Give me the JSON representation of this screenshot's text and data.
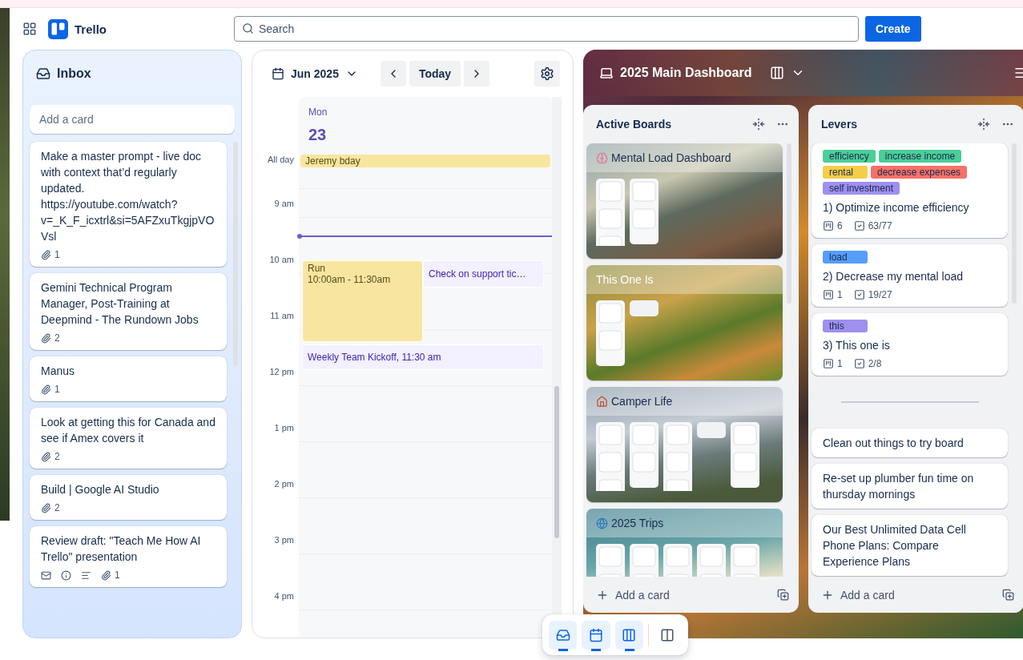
{
  "header": {
    "app_name": "Trello",
    "search": {
      "placeholder": "Search"
    },
    "create_label": "Create"
  },
  "inbox": {
    "title": "Inbox",
    "add_placeholder": "Add a card",
    "cards": [
      {
        "title": "Make a master prompt - live doc with context that’d regularly updated. https://youtube.com/watch?v=_K_F_icxtrl&si=5AFZxuTkgjpVOVsl",
        "badges": [
          {
            "kind": "attachment",
            "count": "1"
          }
        ]
      },
      {
        "title": "Gemini Technical Program Manager, Post-Training at Deepmind - The Rundown Jobs",
        "badges": [
          {
            "kind": "attachment",
            "count": "2"
          }
        ]
      },
      {
        "title": "Manus",
        "badges": [
          {
            "kind": "attachment",
            "count": "1"
          }
        ]
      },
      {
        "title": "Look at getting this for Canada and see if Amex covers it",
        "badges": [
          {
            "kind": "attachment",
            "count": "2"
          }
        ]
      },
      {
        "title": "Build | Google AI Studio",
        "badges": [
          {
            "kind": "attachment",
            "count": "2"
          }
        ]
      },
      {
        "title": "Review draft: \"Teach Me How AI Trello\" presentation",
        "badges": [
          {
            "kind": "email"
          },
          {
            "kind": "info"
          },
          {
            "kind": "description"
          },
          {
            "kind": "attachment",
            "count": "1"
          }
        ]
      }
    ]
  },
  "calendar": {
    "month": "Jun 2025",
    "today_label": "Today",
    "day_name": "Mon",
    "day_number": "23",
    "all_day_label": "All day",
    "all_day_events": [
      {
        "title": "Jeremy bday",
        "color": "#f8e6a0"
      }
    ],
    "hours": [
      "9 am",
      "10 am",
      "11 am",
      "12 pm",
      "1 pm",
      "2 pm",
      "3 pm",
      "4 pm"
    ],
    "event_rows": [
      [
        {
          "title": "Run",
          "time": "10:00am - 11:30am",
          "color": "#f8e6a0"
        },
        {
          "title": "Check on support tic…",
          "color": "#f3f0ff"
        }
      ],
      [
        {
          "title": "Weekly Team Kickoff, 11:30 am",
          "color": "#f3f0ff"
        }
      ]
    ]
  },
  "board": {
    "title": "2025 Main Dashboard",
    "lists": [
      {
        "title": "Active Boards",
        "add_label": "Add a card",
        "cards": [
          {
            "kind": "brain",
            "title": "Mental Load Dashboard"
          },
          {
            "kind": "plain",
            "title": "This One Is"
          },
          {
            "kind": "house",
            "title": "Camper Life"
          },
          {
            "kind": "globe",
            "title": "2025 Trips"
          }
        ]
      },
      {
        "title": "Levers",
        "add_label": "Add a card",
        "cards": [
          {
            "kind": "card",
            "labels": [
              {
                "text": "efficiency",
                "color": "#4bce97"
              },
              {
                "text": "increase income",
                "color": "#4bce97"
              },
              {
                "text": "rental",
                "color": "#f5cd47"
              },
              {
                "text": "decrease expenses",
                "color": "#f87168"
              },
              {
                "text": "self investment",
                "color": "#9f8fef"
              }
            ],
            "title": "1) Optimize income efficiency",
            "boards": "6",
            "checklist": "63/77"
          },
          {
            "kind": "card",
            "labels": [
              {
                "text": "load",
                "color": "#579dff"
              }
            ],
            "title": "2) Decrease my mental load",
            "boards": "1",
            "checklist": "19/27"
          },
          {
            "kind": "card",
            "labels": [
              {
                "text": "this",
                "color": "#9f8fef"
              }
            ],
            "title": "3) This one is",
            "boards": "1",
            "checklist": "2/8"
          },
          {
            "kind": "separator"
          },
          {
            "kind": "card",
            "title": "Clean out things to try board"
          },
          {
            "kind": "card",
            "title": "Re-set up plumber fun time on thursday mornings"
          },
          {
            "kind": "card",
            "title": "Our Best Unlimited Data Cell Phone Plans: Compare Experience Plans"
          }
        ]
      }
    ]
  },
  "dock": [
    {
      "kind": "inbox",
      "selected": true
    },
    {
      "kind": "calendar",
      "selected": true
    },
    {
      "kind": "board",
      "selected": true
    },
    {
      "kind": "switch",
      "selected": false
    }
  ]
}
